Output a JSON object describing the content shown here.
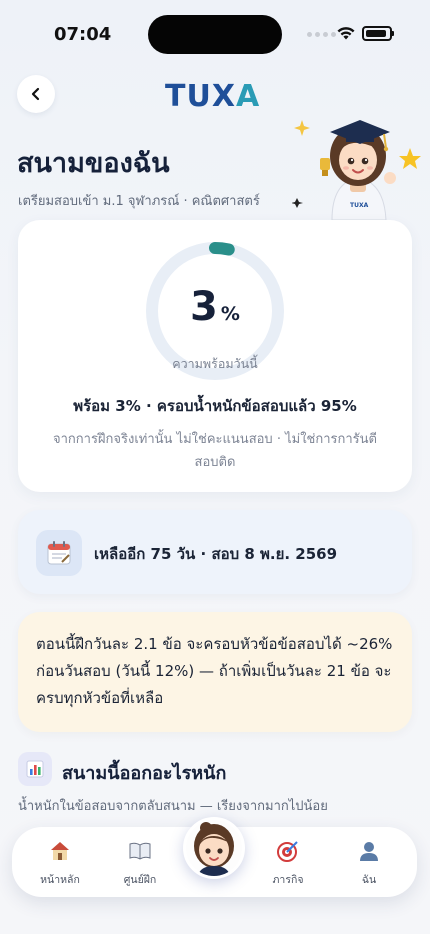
{
  "status_bar": {
    "time": "07:04"
  },
  "header": {
    "logo_main": "TUX",
    "logo_accent": "A"
  },
  "page": {
    "title": "สนามของฉัน",
    "subtitle": "เตรียมสอบเข้า ม.1 จุฬาภรณ์ · คณิตศาสตร์"
  },
  "readiness": {
    "value": "3",
    "unit": "%",
    "value_fraction": 0.03,
    "label": "ความพร้อมวันนี้",
    "summary": "พร้อม 3% · ครอบน้ำหนักข้อสอบแล้ว 95%",
    "note": "จากการฝึกจริงเท่านั้น ไม่ใช่คะแนนสอบ · ไม่ใช่การการันตีสอบติด"
  },
  "countdown": {
    "text": "เหลืออีก 75 วัน · สอบ 8 พ.ย. 2569"
  },
  "pace": {
    "text": "ตอนนี้ฝึกวันละ 2.1 ข้อ จะครอบหัวข้อข้อสอบได้ ~26% ก่อนวันสอบ (วันนี้ 12%) — ถ้าเพิ่มเป็นวันละ 21 ข้อ จะครบทุกหัวข้อที่เหลือ"
  },
  "section": {
    "title": "สนามนี้ออกอะไรหนัก",
    "subtitle": "น้ำหนักในข้อสอบจากตลับสนาม — เรียงจากมากไปน้อย"
  },
  "nav": {
    "items": [
      {
        "label": "หน้าหลัก",
        "icon": "house-icon"
      },
      {
        "label": "ศูนย์ฝึก",
        "icon": "book-icon"
      },
      {
        "label": "ภารกิจ",
        "icon": "target-icon"
      },
      {
        "label": "ฉัน",
        "icon": "user-icon"
      }
    ]
  },
  "colors": {
    "accent_teal": "#2a8f8a",
    "gauge_track": "#e8eef6",
    "pace_bg": "#fdf5e5",
    "countdown_bg": "#eef3fb",
    "logo_blue": "#1f4f99"
  }
}
